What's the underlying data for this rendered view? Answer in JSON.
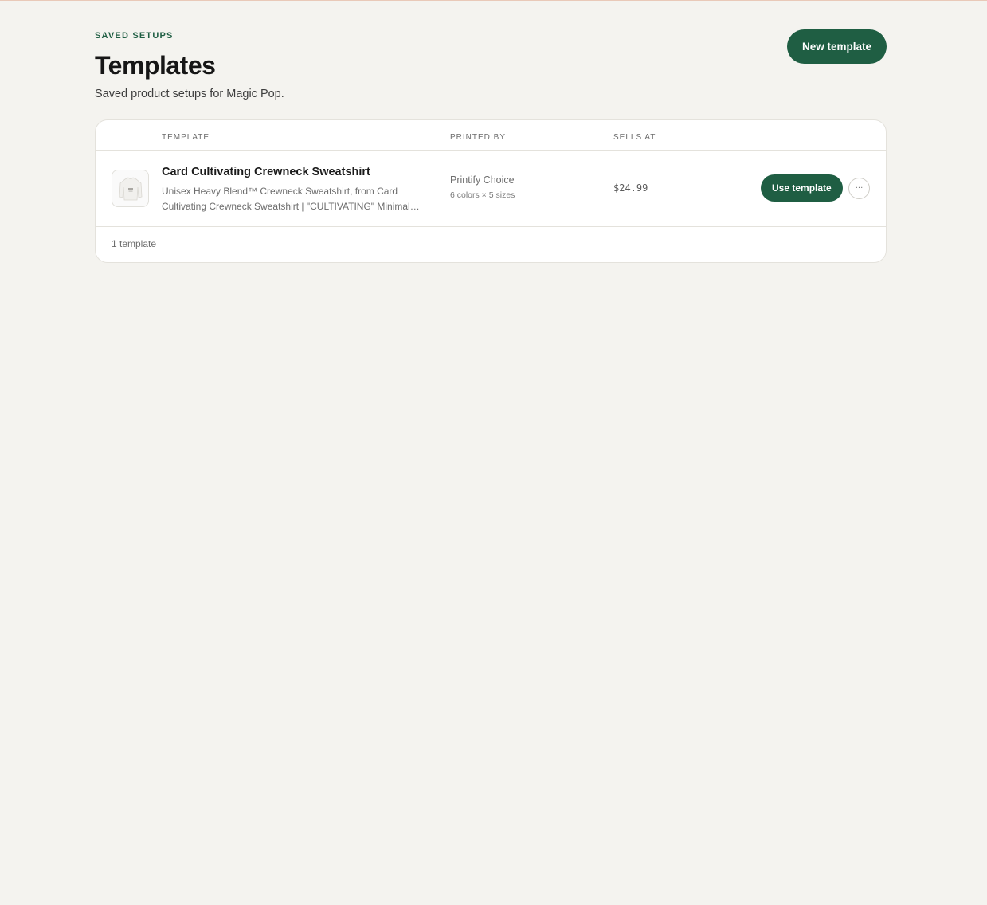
{
  "header": {
    "eyebrow": "SAVED SETUPS",
    "title": "Templates",
    "subtitle": "Saved product setups for Magic Pop.",
    "new_button": "New template"
  },
  "table": {
    "columns": {
      "template": "TEMPLATE",
      "printed_by": "PRINTED BY",
      "sells_at": "SELLS AT"
    },
    "rows": [
      {
        "thumbnail_icon": "sweatshirt-icon",
        "title": "Card Cultivating Crewneck Sweatshirt",
        "description_line1": "Unisex Heavy Blend™ Crewneck Sweatshirt, from Card",
        "description_line2": "Cultivating Crewneck Sweatshirt | \"CULTIVATING\" Minimal…",
        "printer": "Printify Choice",
        "variants": "6 colors × 5 sizes",
        "price": "$24.99",
        "use_button": "Use template",
        "more_icon": "ellipsis-icon",
        "more_label": "···"
      }
    ],
    "footer": "1 template"
  },
  "colors": {
    "accent": "#1f5e43",
    "background": "#f4f3ef",
    "card": "#ffffff"
  }
}
